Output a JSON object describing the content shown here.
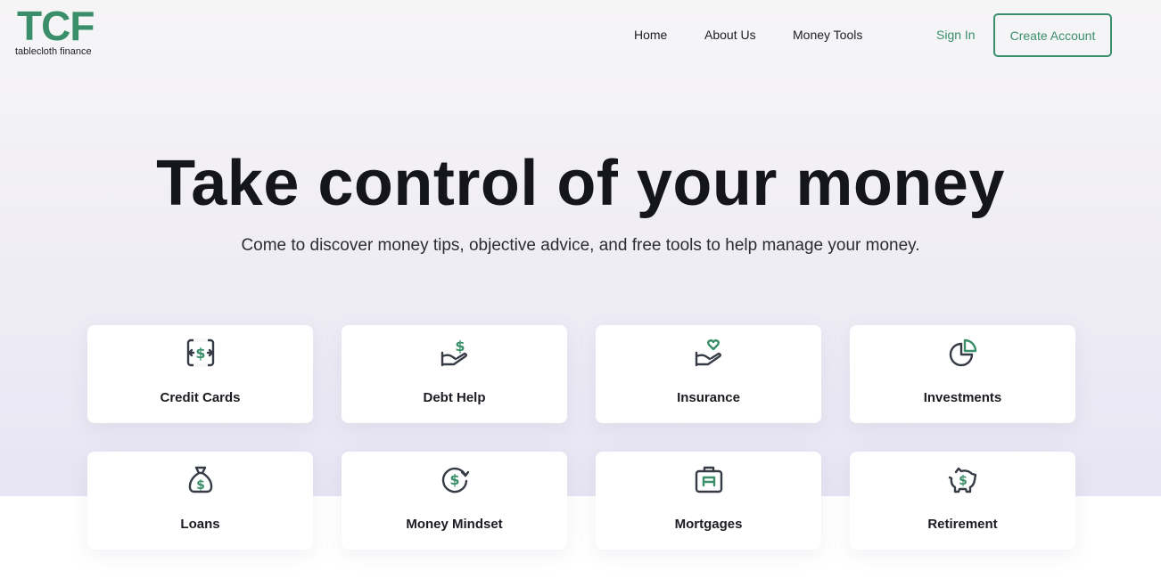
{
  "brand": {
    "logo_text": "TCF",
    "tagline": "tablecloth finance",
    "accent_color": "#3a8f6a"
  },
  "nav": {
    "items": [
      {
        "label": "Home"
      },
      {
        "label": "About Us"
      },
      {
        "label": "Money Tools"
      }
    ],
    "sign_in": "Sign In",
    "create_account": "Create Account"
  },
  "hero": {
    "title": "Take control of your money",
    "subtitle": "Come to discover money tips, objective advice, and free tools to help manage your money."
  },
  "categories": [
    {
      "label": "Credit Cards",
      "icon": "credit-card-exchange-icon"
    },
    {
      "label": "Debt Help",
      "icon": "hand-dollar-icon"
    },
    {
      "label": "Insurance",
      "icon": "hand-heart-icon"
    },
    {
      "label": "Investments",
      "icon": "pie-chart-icon"
    },
    {
      "label": "Loans",
      "icon": "money-bag-icon"
    },
    {
      "label": "Money Mindset",
      "icon": "dollar-circle-icon"
    },
    {
      "label": "Mortgages",
      "icon": "briefcase-icon"
    },
    {
      "label": "Retirement",
      "icon": "piggy-bank-icon"
    }
  ]
}
